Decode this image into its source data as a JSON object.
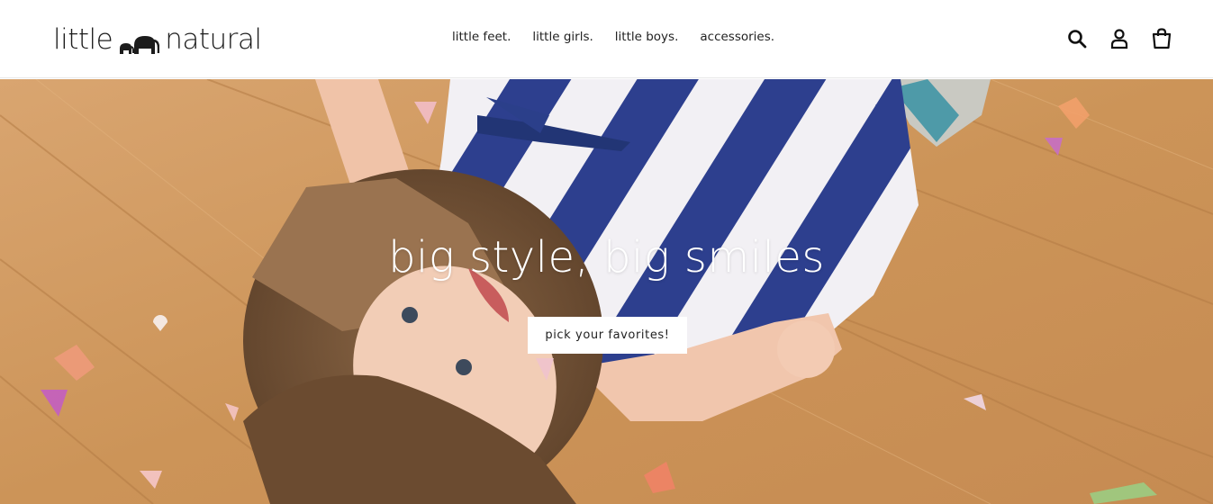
{
  "header": {
    "logo_text_left": "little",
    "logo_text_right": "natural",
    "logo_icon": "elephants-icon",
    "nav": [
      {
        "label": "little feet."
      },
      {
        "label": "little girls."
      },
      {
        "label": "little boys."
      },
      {
        "label": "accessories."
      }
    ],
    "icons": [
      "search-icon",
      "account-icon",
      "cart-icon"
    ]
  },
  "hero": {
    "title": "big style, big smiles",
    "button_label": "pick your favorites!"
  },
  "colors": {
    "floor": "#cf9b62",
    "dress_blue": "#2c3f8c",
    "dress_white": "#f3f1f4",
    "text_dark": "#1c1c1c"
  }
}
